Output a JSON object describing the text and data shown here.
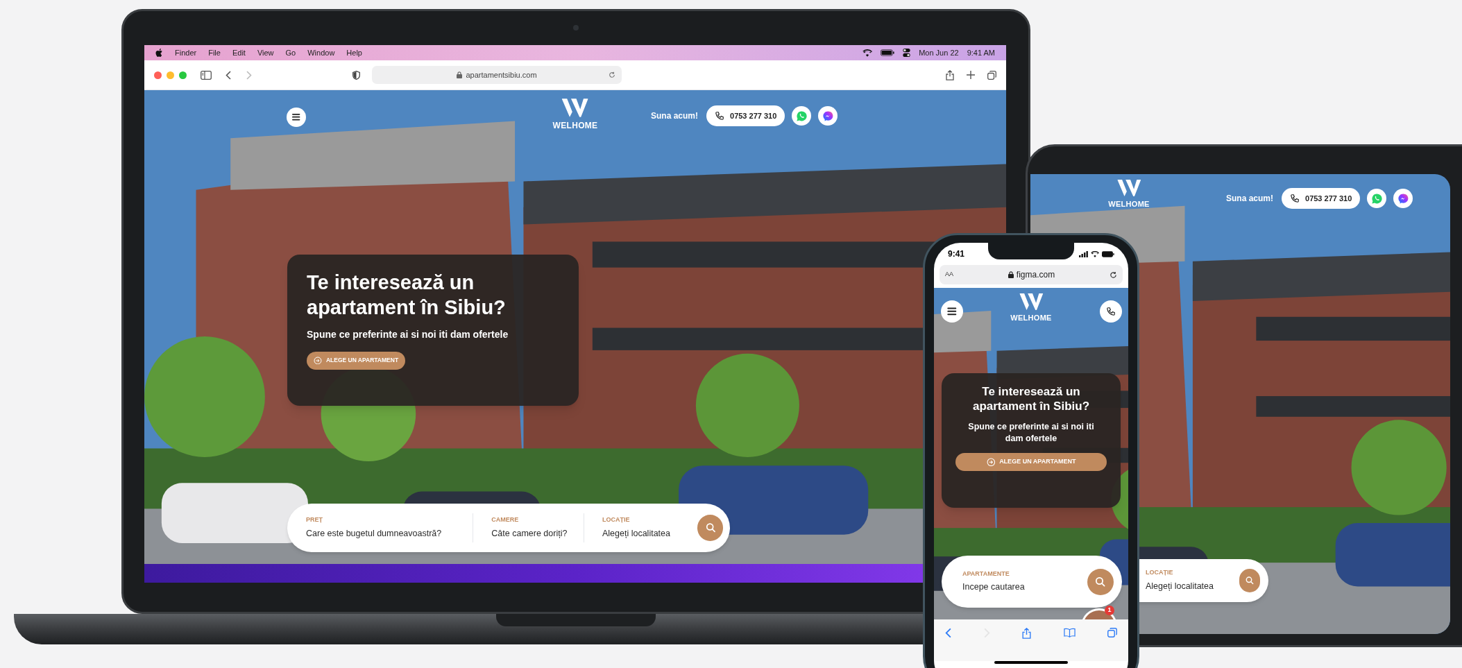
{
  "laptop": {
    "menu_bar": {
      "items": [
        "Finder",
        "File",
        "Edit",
        "View",
        "Go",
        "Window",
        "Help"
      ],
      "date": "Mon Jun 22",
      "time": "9:41 AM"
    },
    "browser": {
      "url": "apartamentsibiu.com"
    },
    "site": {
      "brand": "WELHOME",
      "call_label": "Suna acum!",
      "phone": "0753 277 310",
      "hero": {
        "title": "Te interesează un apartament în Sibiu?",
        "subtitle": "Spune ce preferinte ai si noi iti dam ofertele",
        "button": "ALEGE UN APARTAMENT"
      },
      "search": {
        "fields": [
          {
            "label": "PREȚ",
            "placeholder": "Care este bugetul dumneavoastră?"
          },
          {
            "label": "CAMERE",
            "placeholder": "Câte camere doriți?"
          },
          {
            "label": "LOCAȚIE",
            "placeholder": "Alegeți localitatea"
          }
        ]
      }
    }
  },
  "tablet": {
    "site": {
      "brand": "WELHOME",
      "call_label": "Suna acum!",
      "phone": "0753 277 310",
      "search": {
        "fields": [
          {
            "label": "LOCAȚIE",
            "placeholder": "Alegeți localitatea"
          }
        ]
      }
    }
  },
  "phone": {
    "status_bar": {
      "time": "9:41"
    },
    "browser": {
      "text_size": "AA",
      "url": "figma.com"
    },
    "site": {
      "brand": "WELHOME",
      "hero": {
        "title": "Te interesează un apartament în Sibiu?",
        "subtitle": "Spune ce preferinte ai si noi iti dam ofertele",
        "button": "ALEGE UN APARTAMENT"
      },
      "search": {
        "fields": [
          {
            "label": "APARTAMENTE",
            "placeholder": "Incepe cautarea"
          }
        ]
      },
      "chat_badge": "1"
    }
  }
}
